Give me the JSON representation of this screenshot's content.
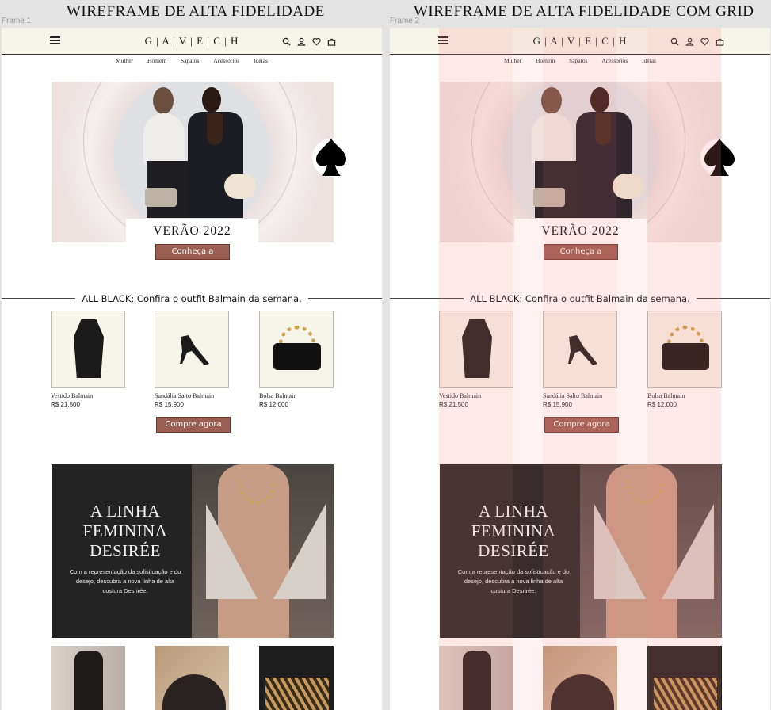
{
  "titles": {
    "frame1": "WIREFRAME DE ALTA FIDELIDADE",
    "frame2": "WIREFRAME DE ALTA FIDELIDADE COM GRID"
  },
  "frame_labels": [
    "Frame 1",
    "Frame 2"
  ],
  "header": {
    "logo": "G | A | V | E | C | H",
    "icons": [
      "menu-icon",
      "search-icon",
      "user-icon",
      "heart-icon",
      "bag-icon"
    ]
  },
  "nav": [
    "Mulher",
    "Homem",
    "Sapatos",
    "Acessórios",
    "Idéias"
  ],
  "hero": {
    "title": "VERÃO 2022",
    "cta": "Conheça a seleção"
  },
  "section": {
    "heading": "ALL BLACK: Confira o outfit Balmain da semana.",
    "cta": "Compre agora"
  },
  "products": [
    {
      "name": "Vestido Balmain",
      "price": "R$ 21.500"
    },
    {
      "name": "Sandália Salto Balmain",
      "price": "R$ 15.900"
    },
    {
      "name": "Bolsa Balmain",
      "price": "R$ 12.000"
    }
  ],
  "feature": {
    "title_lines": [
      "A LINHA",
      "FEMININA",
      "DESIRÉE"
    ],
    "description": "Com a representação da sofisticação e do desejo, descubra a nova linha de alta costura Desrirée."
  },
  "colors": {
    "header_bg": "#f7f4ea",
    "accent_button": "#9a5f52",
    "grid_overlay": "#ff8282"
  }
}
